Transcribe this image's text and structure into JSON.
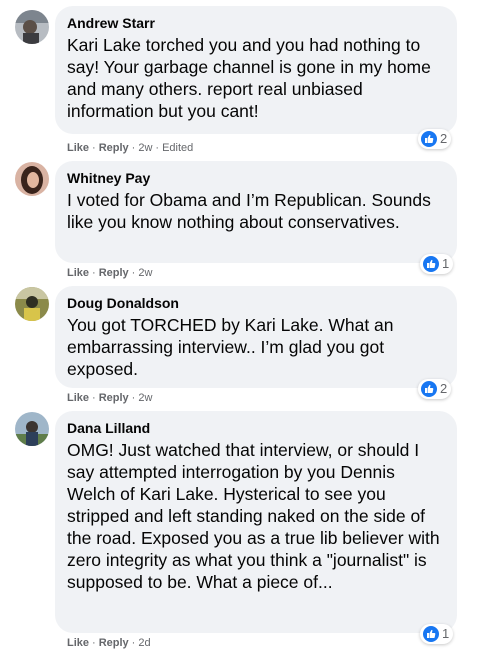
{
  "comments": [
    {
      "author": "Andrew Starr",
      "text": "Kari Lake torched you and you had nothing to say! Your garbage channel is gone in my home and many others. report real unbiased information but you cant!",
      "like": "Like",
      "reply": "Reply",
      "time": "2w",
      "edited": "Edited",
      "reactions": "2",
      "avatar_color": "#8a8f96"
    },
    {
      "author": "Whitney Pay",
      "text": "I voted for Obama and I’m Republican. Sounds like you know nothing about conservatives.",
      "like": "Like",
      "reply": "Reply",
      "time": "2w",
      "reactions": "1",
      "avatar_color": "#5a3a2e"
    },
    {
      "author": "Doug Donaldson",
      "text": "You got TORCHED by Kari Lake. What an embarrassing interview.. I’m glad you got exposed.",
      "like": "Like",
      "reply": "Reply",
      "time": "2w",
      "reactions": "2",
      "avatar_color": "#6b6a2a"
    },
    {
      "author": "Dana Lilland",
      "text": "OMG! Just watched that interview, or should I say attempted interrogation by you Dennis Welch of Kari Lake. Hysterical to see you stripped and left standing naked on the side of the road. Exposed you as a true lib believer with zero integrity as what you think a \"journalist\" is supposed to be. What a piece of...",
      "like": "Like",
      "reply": "Reply",
      "time": "2d",
      "reactions": "1",
      "avatar_color": "#4c6a86"
    }
  ],
  "colors": {
    "bubble": "#f0f2f5",
    "meta": "#65676b",
    "like_blue": "#1877f2"
  }
}
